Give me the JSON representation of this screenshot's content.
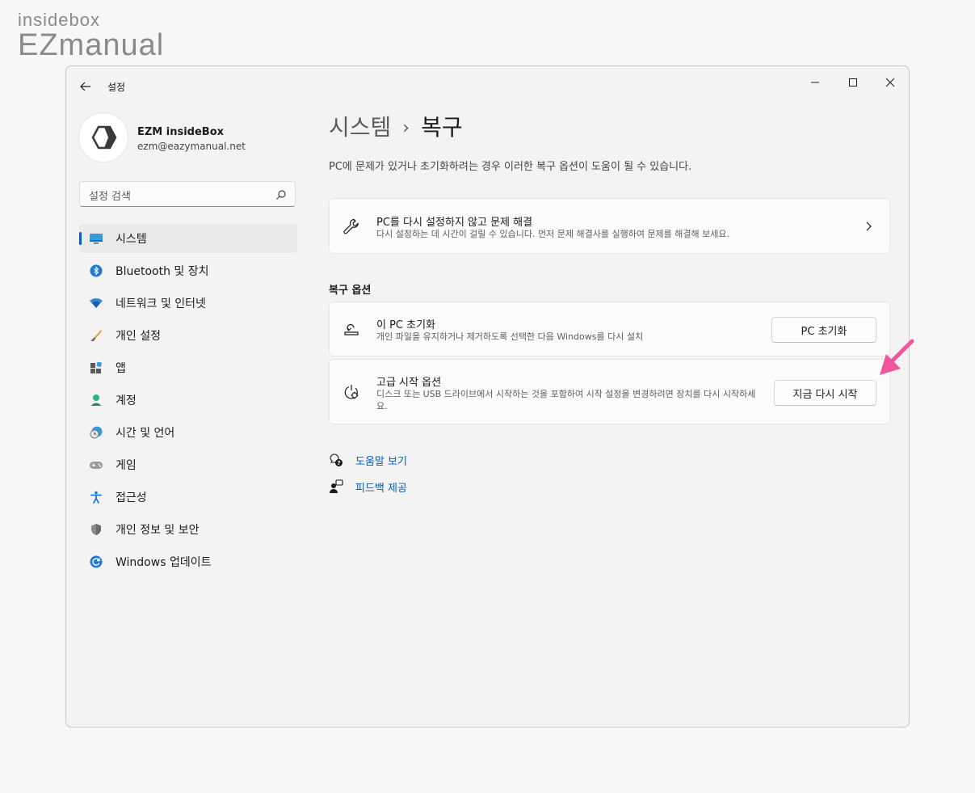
{
  "watermark": {
    "line1": "insidebox",
    "line2": "EZmanual"
  },
  "window": {
    "title": "설정"
  },
  "profile": {
    "name": "EZM insideBox",
    "email": "ezm@eazymanual.net"
  },
  "search": {
    "placeholder": "설정 검색"
  },
  "sidebar": {
    "items": [
      {
        "label": "시스템",
        "icon": "system-icon",
        "active": true
      },
      {
        "label": "Bluetooth 및 장치",
        "icon": "bluetooth-icon"
      },
      {
        "label": "네트워크 및 인터넷",
        "icon": "wifi-icon"
      },
      {
        "label": "개인 설정",
        "icon": "brush-icon"
      },
      {
        "label": "앱",
        "icon": "apps-icon"
      },
      {
        "label": "계정",
        "icon": "account-icon"
      },
      {
        "label": "시간 및 언어",
        "icon": "time-language-icon"
      },
      {
        "label": "게임",
        "icon": "gamepad-icon"
      },
      {
        "label": "접근성",
        "icon": "accessibility-icon"
      },
      {
        "label": "개인 정보 및 보안",
        "icon": "shield-icon"
      },
      {
        "label": "Windows 업데이트",
        "icon": "update-icon"
      }
    ]
  },
  "main": {
    "breadcrumb": {
      "parent": "시스템",
      "separator": "›",
      "current": "복구"
    },
    "description": "PC에 문제가 있거나 초기화하려는 경우 이러한 복구 옵션이 도움이 될 수 있습니다.",
    "troubleshoot": {
      "title": "PC를 다시 설정하지 않고 문제 해결",
      "subtitle": "다시 설정하는 데 시간이 걸릴 수 있습니다. 먼저 문제 해결사를 실행하여 문제를 해결해 보세요."
    },
    "section_title": "복구 옵션",
    "reset": {
      "title": "이 PC 초기화",
      "subtitle": "개인 파일을 유지하거나 제거하도록 선택한 다음 Windows를 다시 설치",
      "button": "PC 초기화"
    },
    "advanced": {
      "title": "고급 시작 옵션",
      "subtitle": "디스크 또는 USB 드라이브에서 시작하는 것을 포함하여 시작 설정을 변경하려면 장치를 다시 시작하세요.",
      "button": "지금 다시 시작"
    },
    "links": {
      "help": "도움말 보기",
      "feedback": "피드백 제공"
    }
  },
  "colors": {
    "accent": "#005fb8",
    "annotation_arrow": "#f0569a"
  }
}
